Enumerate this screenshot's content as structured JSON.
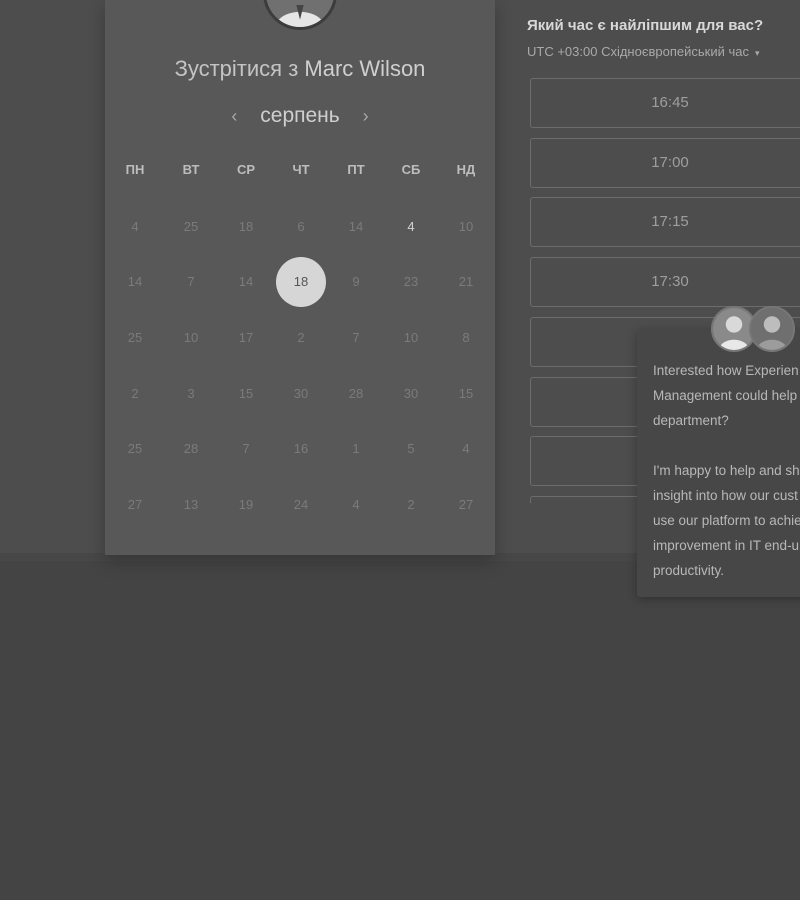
{
  "booking": {
    "title_prefix": "Зустрітися з",
    "host_name": "Marc Wilson",
    "month": "серпень",
    "prev_arrow": "‹",
    "next_arrow": "›",
    "weekdays": [
      "ПН",
      "ВТ",
      "СР",
      "ЧТ",
      "ПТ",
      "СБ",
      "НД"
    ],
    "weeks": [
      [
        "4",
        "25",
        "18",
        "6",
        "14",
        "4",
        "10"
      ],
      [
        "14",
        "7",
        "14",
        "18",
        "9",
        "23",
        "21"
      ],
      [
        "25",
        "10",
        "17",
        "2",
        "7",
        "10",
        "8"
      ],
      [
        "2",
        "3",
        "15",
        "30",
        "28",
        "30",
        "15"
      ],
      [
        "25",
        "28",
        "7",
        "16",
        "1",
        "5",
        "4"
      ],
      [
        "27",
        "13",
        "19",
        "24",
        "4",
        "2",
        "27"
      ]
    ],
    "available_days": [
      [
        0,
        5
      ]
    ],
    "selected_day": [
      1,
      3
    ]
  },
  "times": {
    "question": "Який час є найліпшим для вас?",
    "timezone": "UTC +03:00 Східноєвропейський час",
    "caret": "▾",
    "slots": [
      "16:45",
      "17:00",
      "17:15",
      "17:30",
      "",
      "",
      "",
      ""
    ]
  },
  "chat": {
    "message": "Interested how Experien\nManagement could help\ndepartment?\n\nI'm happy to help and sh\ninsight into how our cust\nuse our platform to achie\nimprovement in IT end-u\nproductivity."
  },
  "icons": {
    "host_avatar": "person-photo",
    "chat_avatar_1": "person-photo",
    "chat_avatar_2": "person-photo"
  }
}
